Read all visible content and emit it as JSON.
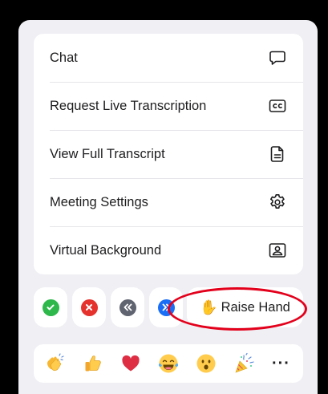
{
  "menu": {
    "items": [
      {
        "label": "Chat",
        "icon": "chat-bubble-icon"
      },
      {
        "label": "Request Live Transcription",
        "icon": "cc-icon"
      },
      {
        "label": "View Full Transcript",
        "icon": "document-icon"
      },
      {
        "label": "Meeting Settings",
        "icon": "gear-icon"
      },
      {
        "label": "Virtual Background",
        "icon": "person-frame-icon"
      }
    ]
  },
  "status_buttons": {
    "items": [
      {
        "icon": "yes-check-icon",
        "color": "#2eb84b"
      },
      {
        "icon": "no-x-icon",
        "color": "#e5322d"
      },
      {
        "icon": "slow-down-icon",
        "color": "#5f6470"
      },
      {
        "icon": "speed-up-icon",
        "color": "#1a6ef5"
      }
    ]
  },
  "raise_hand": {
    "emoji": "✋",
    "label": "Raise Hand",
    "highlight_color": "#e3001b"
  },
  "reactions": {
    "items": [
      {
        "emoji": "👏",
        "name": "clap"
      },
      {
        "emoji": "👍",
        "name": "thumbs-up"
      },
      {
        "emoji": "❤️",
        "name": "heart"
      },
      {
        "emoji": "😂",
        "name": "joy"
      },
      {
        "emoji": "😮",
        "name": "surprised"
      },
      {
        "emoji": "🎉",
        "name": "party"
      }
    ],
    "more": "···"
  }
}
